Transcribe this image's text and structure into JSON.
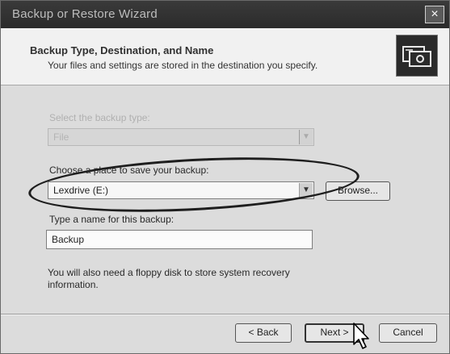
{
  "window": {
    "title": "Backup or Restore Wizard",
    "close_label": "×"
  },
  "header": {
    "title": "Backup Type, Destination, and Name",
    "subtitle": "Your files and settings are stored in the destination you specify."
  },
  "form": {
    "backup_type_label": "Select the backup type:",
    "backup_type_value": "File",
    "destination_label": "Choose a place to save your backup:",
    "destination_value": "Lexdrive (E:)",
    "browse_label": "Browse...",
    "name_label": "Type a name for this backup:",
    "name_value": "Backup",
    "note": "You will also need a floppy disk to store system recovery information."
  },
  "buttons": {
    "back": "< Back",
    "next": "Next >",
    "cancel": "Cancel"
  },
  "icons": {
    "combo_arrow": "chevron-down-icon",
    "header": "backup-icon",
    "cursor": "mouse-pointer-icon"
  },
  "colors": {
    "titlebar": "#2b2b2b",
    "header_bg": "#f1f1f1",
    "window_bg": "#dcdcdc",
    "annotation_ellipse": "#1e1e1e"
  }
}
